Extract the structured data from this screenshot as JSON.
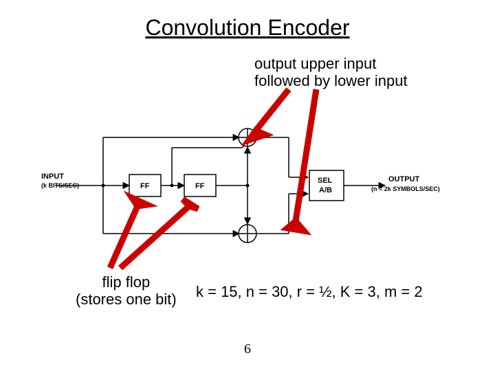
{
  "title": "Convolution Encoder",
  "annotations": {
    "upper_line1": "output upper input",
    "upper_line2": "followed by lower input",
    "lower_line1": "flip flop",
    "lower_line2": "(stores one bit)"
  },
  "params_text": "k = 15, n = 30, r = ½, K = 3, m = 2",
  "page_number": "6",
  "diagram": {
    "input_label_line1": "INPUT",
    "input_label_line2": "(k BITS/SEC)",
    "ff1_label": "FF",
    "ff2_label": "FF",
    "sel_line1": "SEL",
    "sel_line2": "A/B",
    "output_label_line1": "OUTPUT",
    "output_label_line2": "(n = 2k SYMBOLS/SEC)"
  },
  "chart_data": {
    "type": "diagram",
    "title": "Convolution Encoder",
    "blocks": [
      {
        "name": "INPUT",
        "subtitle": "(k BITS/SEC)"
      },
      {
        "name": "FF",
        "role": "flip-flop 1"
      },
      {
        "name": "FF",
        "role": "flip-flop 2"
      },
      {
        "name": "XOR",
        "role": "upper adder"
      },
      {
        "name": "XOR",
        "role": "lower adder"
      },
      {
        "name": "SEL A/B",
        "role": "selector / mux"
      },
      {
        "name": "OUTPUT",
        "subtitle": "(n = 2k SYMBOLS/SEC)"
      }
    ],
    "connections": [
      {
        "from": "INPUT",
        "to": "FF1"
      },
      {
        "from": "FF1",
        "to": "FF2"
      },
      {
        "from": "INPUT",
        "to": "XOR_upper"
      },
      {
        "from": "FF1",
        "to": "XOR_upper"
      },
      {
        "from": "FF2",
        "to": "XOR_upper"
      },
      {
        "from": "INPUT",
        "to": "XOR_lower"
      },
      {
        "from": "FF2",
        "to": "XOR_lower"
      },
      {
        "from": "XOR_upper",
        "to": "SEL"
      },
      {
        "from": "XOR_lower",
        "to": "SEL"
      },
      {
        "from": "SEL",
        "to": "OUTPUT"
      }
    ],
    "parameters": {
      "k": 15,
      "n": 30,
      "r": "1/2",
      "K": 3,
      "m": 2
    },
    "callouts": [
      {
        "text": "output upper input followed by lower input",
        "points_to": [
          "XOR_upper",
          "XOR_lower"
        ]
      },
      {
        "text": "flip flop (stores one bit)",
        "points_to": [
          "FF1",
          "FF2"
        ]
      }
    ]
  }
}
